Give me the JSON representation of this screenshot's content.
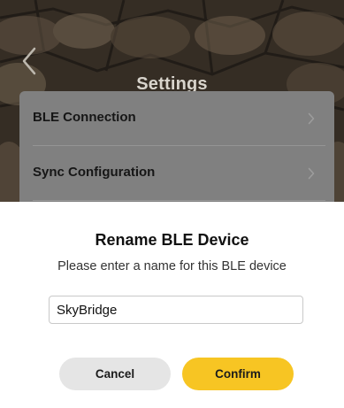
{
  "header": {
    "title": "Settings",
    "back_icon": "chevron-left-icon"
  },
  "settings": {
    "items": [
      {
        "label": "BLE Connection",
        "icon": "chevron-right-icon"
      },
      {
        "label": "Sync Configuration",
        "icon": "chevron-right-icon"
      }
    ]
  },
  "dialog": {
    "title": "Rename BLE Device",
    "message": "Please enter a name for this BLE device",
    "input_value": "SkyBridge",
    "cancel_label": "Cancel",
    "confirm_label": "Confirm"
  },
  "colors": {
    "accent": "#f7c523",
    "cancel_bg": "#e5e5e5",
    "dialog_bg": "#ffffff",
    "card_bg": "#808080"
  }
}
